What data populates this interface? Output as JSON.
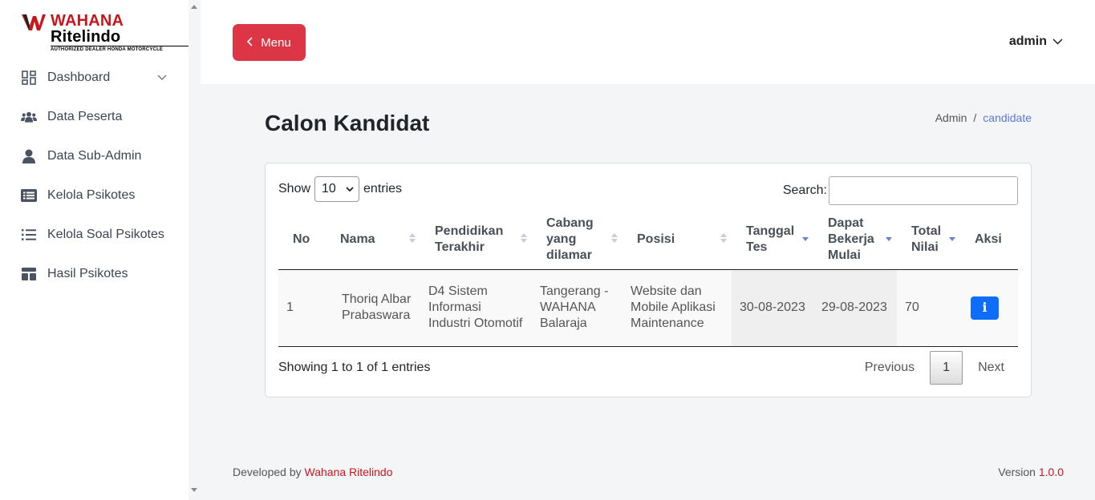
{
  "brand": {
    "name_red": "WAHANA",
    "name_black": "Ritelindo",
    "tagline": "AUTHORIZED DEALER HONDA MOTORCYCLE",
    "colors": {
      "red": "#c8161d",
      "primary": "#0d6efd",
      "danger": "#dc3545",
      "link": "#5a78d6"
    }
  },
  "sidebar": {
    "items": [
      {
        "label": "Dashboard",
        "icon": "dashboard-grid-icon",
        "has_submenu": true
      },
      {
        "label": "Data Peserta",
        "icon": "users-group-icon"
      },
      {
        "label": "Data Sub-Admin",
        "icon": "user-icon"
      },
      {
        "label": "Kelola Psikotes",
        "icon": "list-box-icon"
      },
      {
        "label": "Kelola Soal Psikotes",
        "icon": "list-icon"
      },
      {
        "label": "Hasil Psikotes",
        "icon": "layout-icon"
      }
    ]
  },
  "header": {
    "menu_label": "Menu",
    "user_label": "admin"
  },
  "page": {
    "title": "Calon Kandidat",
    "breadcrumb": {
      "root": "Admin",
      "separator": "/",
      "current": "candidate"
    }
  },
  "table_controls": {
    "show_label": "Show",
    "entries_value": "10",
    "entries_label": "entries",
    "search_label": "Search:",
    "search_value": ""
  },
  "table": {
    "columns": [
      "No",
      "Nama",
      "Pendidikan Terakhir",
      "Cabang yang dilamar",
      "Posisi",
      "Tanggal Tes",
      "Dapat Bekerja Mulai",
      "Total Nilai",
      "Aksi"
    ],
    "rows": [
      {
        "no": "1",
        "nama": "Thoriq Albar Prabaswara",
        "pendidikan": "D4 Sistem Informasi Industri Otomotif",
        "cabang": "Tangerang - WAHANA Balaraja",
        "posisi": "Website dan Mobile Aplikasi Maintenance",
        "tanggal_tes": "30-08-2023",
        "mulai": "29-08-2023",
        "nilai": "70",
        "aksi_icon": "info-icon"
      }
    ]
  },
  "pagination": {
    "info": "Showing 1 to 1 of 1 entries",
    "previous": "Previous",
    "current_page": "1",
    "next": "Next"
  },
  "footer": {
    "developed_by": "Developed by",
    "developer": "Wahana Ritelindo",
    "version_label": "Version",
    "version": "1.0.0"
  }
}
